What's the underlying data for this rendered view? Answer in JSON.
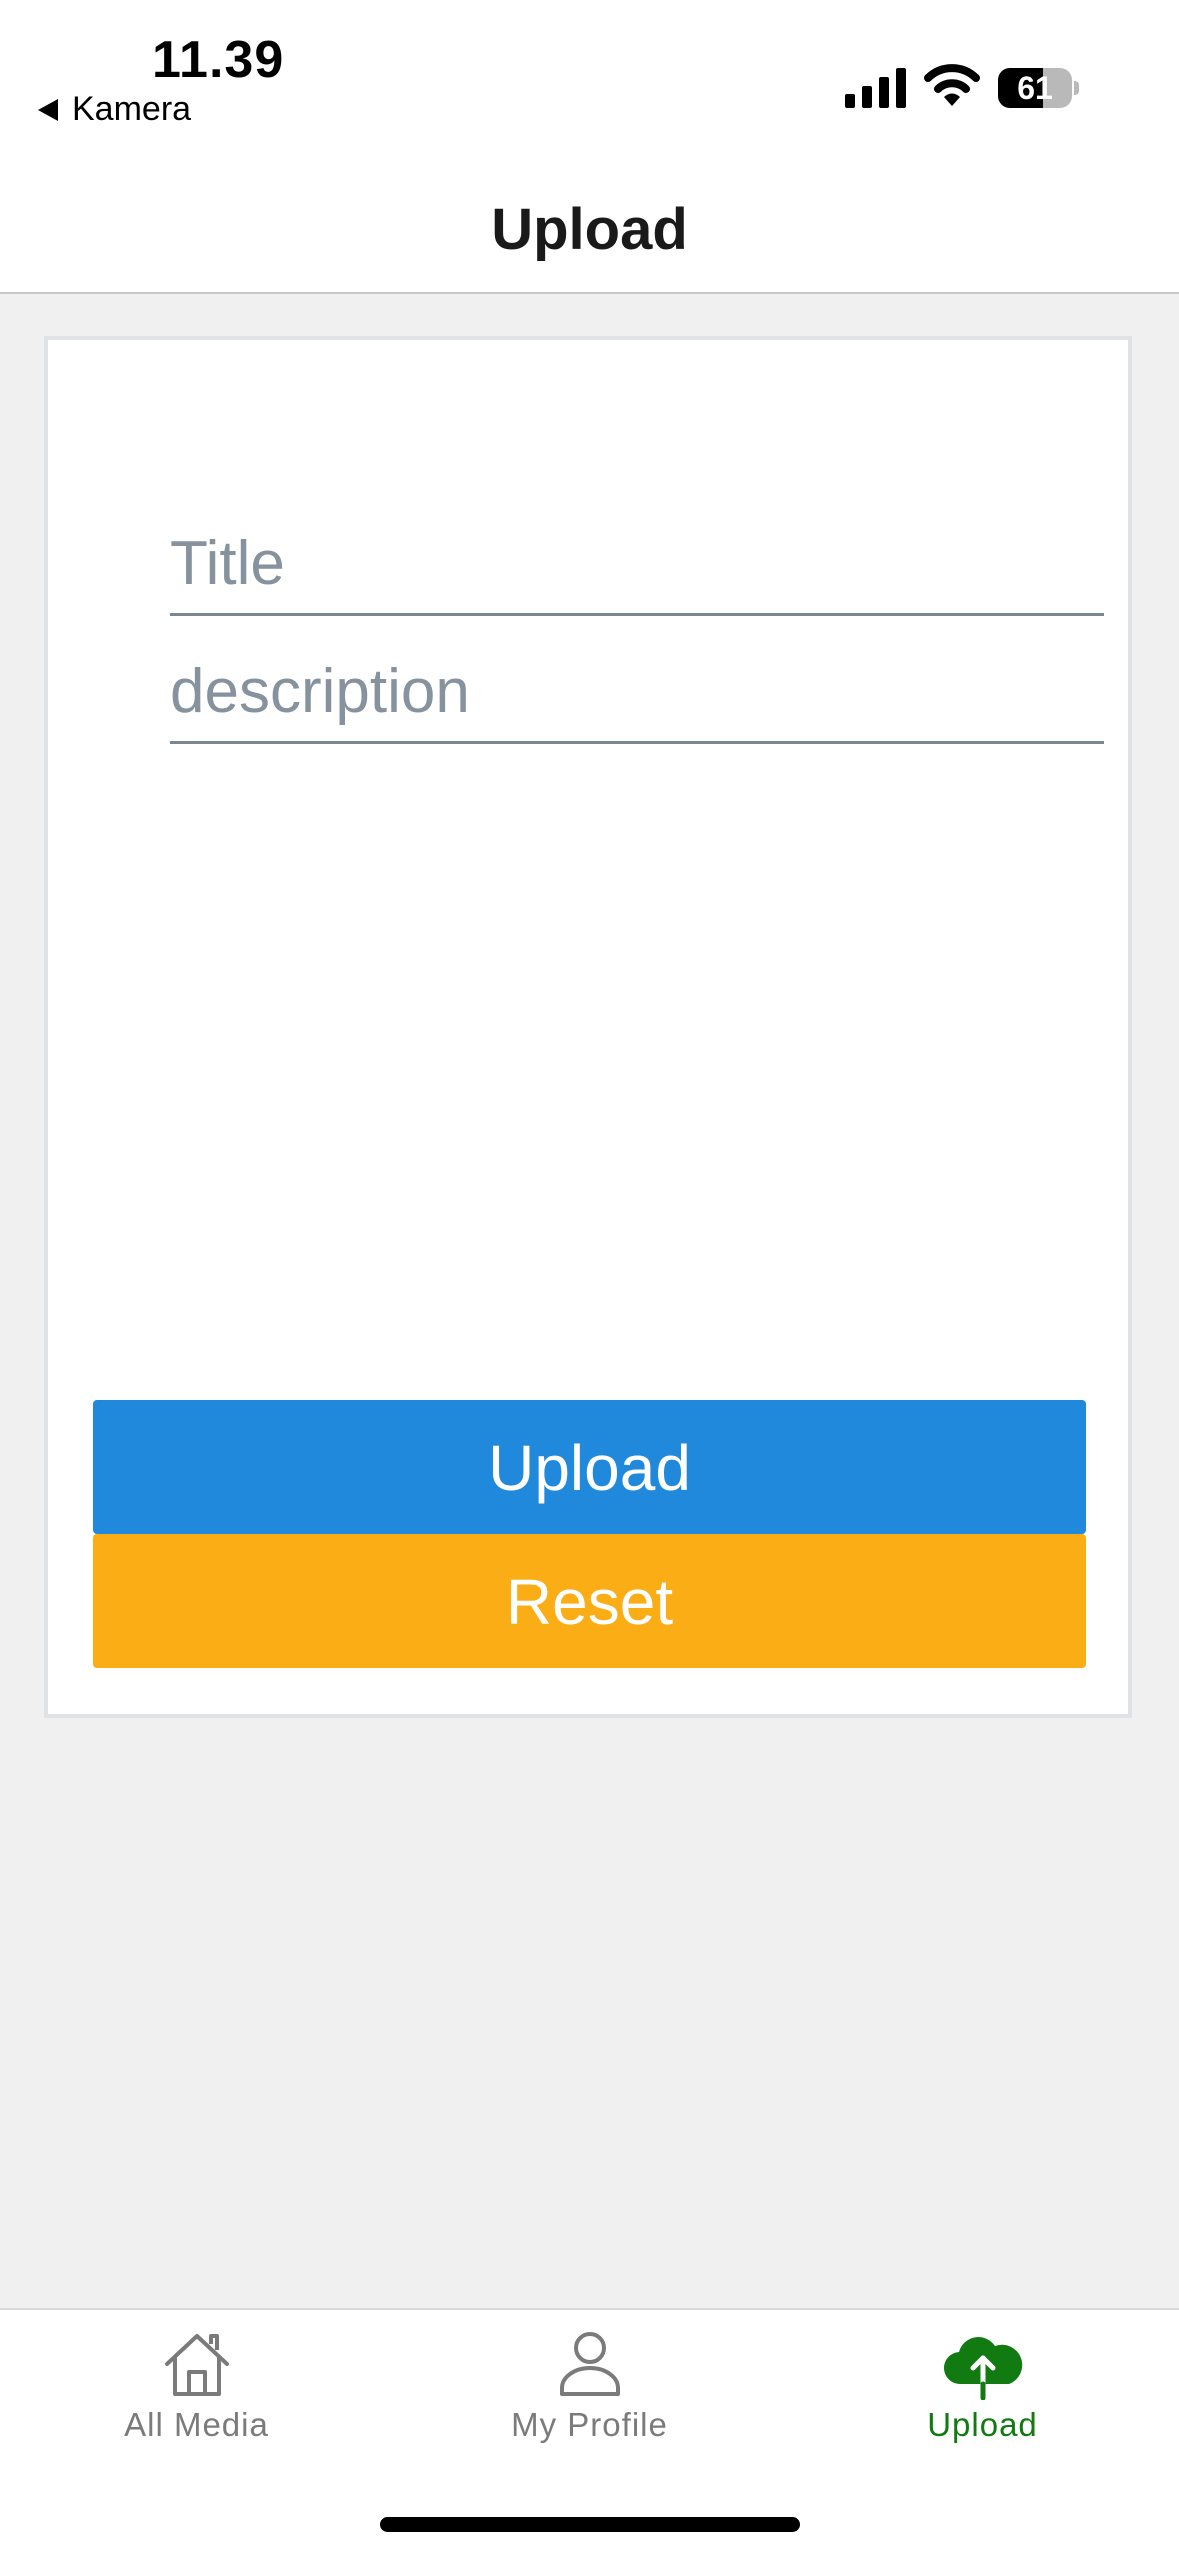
{
  "status_bar": {
    "time": "11.39",
    "back_app": "Kamera",
    "battery_level": "61",
    "battery_fraction": 0.61
  },
  "header": {
    "title": "Upload"
  },
  "form": {
    "title_placeholder": "Title",
    "description_placeholder": "description",
    "upload_label": "Upload",
    "reset_label": "Reset"
  },
  "tab_bar": {
    "tabs": [
      {
        "label": "All Media",
        "icon": "home-icon",
        "active": false
      },
      {
        "label": "My Profile",
        "icon": "person-icon",
        "active": false
      },
      {
        "label": "Upload",
        "icon": "cloud-upload-icon",
        "active": true
      }
    ]
  },
  "colors": {
    "upload_button": "#2189dc",
    "reset_button": "#faad14",
    "active_tab": "#117a11",
    "inactive_tab": "#7b7b7b"
  }
}
